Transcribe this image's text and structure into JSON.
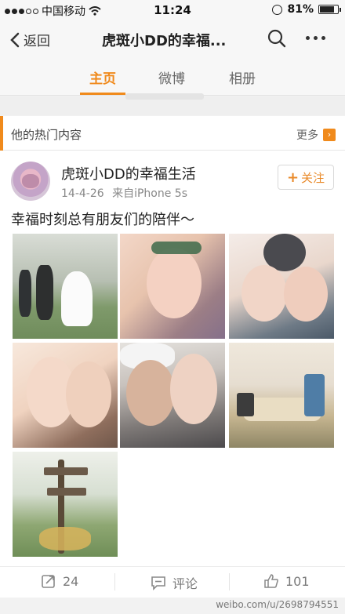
{
  "status_bar": {
    "carrier": "中国移动",
    "time": "11:24",
    "battery": "81%",
    "battery_level": 0.81
  },
  "nav": {
    "back_label": "返回",
    "title": "虎斑小DD的幸福..."
  },
  "tabs": [
    {
      "label": "主页",
      "active": true
    },
    {
      "label": "微博",
      "active": false
    },
    {
      "label": "相册",
      "active": false
    }
  ],
  "hot_section": {
    "title": "他的热门内容",
    "more_label": "更多"
  },
  "post": {
    "author": "虎斑小DD的幸福生活",
    "date": "14-4-26",
    "source": "来自iPhone 5s",
    "follow_label": "关注",
    "text": "幸福时刻总有朋友们的陪伴～",
    "photo_count": 7
  },
  "actions": {
    "repost_count": "24",
    "comment_label": "评论",
    "like_count": "101"
  },
  "watermark": "weibo.com/u/2698794551",
  "colors": {
    "accent": "#f08a1c",
    "follow_text": "#e98a2a"
  }
}
